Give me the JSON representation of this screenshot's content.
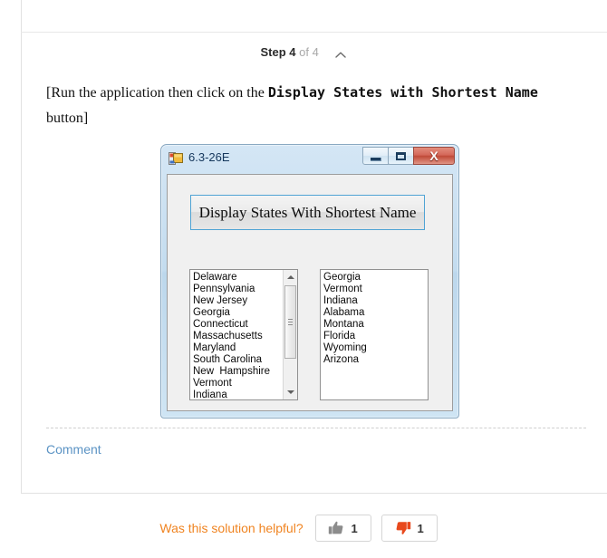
{
  "card": {
    "step": {
      "label": "Step 4",
      "of": "of 4",
      "collapse_icon": "chevron-up-icon"
    },
    "instruction": {
      "prefix": "[Run the application then click on the ",
      "bold_mono": "Display States with Shortest Name",
      "suffix": "button]"
    },
    "comment_link": "Comment"
  },
  "app_window": {
    "title": "6.3-26E",
    "icon": "vb-form-icon",
    "controls": {
      "minimize": "minimize-icon",
      "maximize": "maximize-icon",
      "close": "X"
    },
    "button": {
      "label": "Display States With Shortest Name",
      "border_color": "#4fa3d4"
    },
    "left_listbox": {
      "items": [
        "Delaware",
        "Pennsylvania",
        "New Jersey",
        "Georgia",
        "Connecticut",
        "Massachusetts",
        "Maryland",
        "South Carolina",
        "New  Hampshire",
        "Vermont",
        "Indiana"
      ],
      "has_scrollbar": true
    },
    "right_listbox": {
      "items": [
        "Georgia",
        "Vermont",
        "Indiana",
        "Alabama",
        "Montana",
        "Florida",
        "Wyoming",
        "Arizona"
      ],
      "has_scrollbar": false
    }
  },
  "footer": {
    "question": "Was this solution helpful?",
    "upvote": {
      "icon": "thumbs-up-icon",
      "count": "1",
      "color": "#8c8c8c"
    },
    "downvote": {
      "icon": "thumbs-down-icon",
      "count": "1",
      "color": "#e8491d"
    },
    "accent_color": "#f08421"
  }
}
